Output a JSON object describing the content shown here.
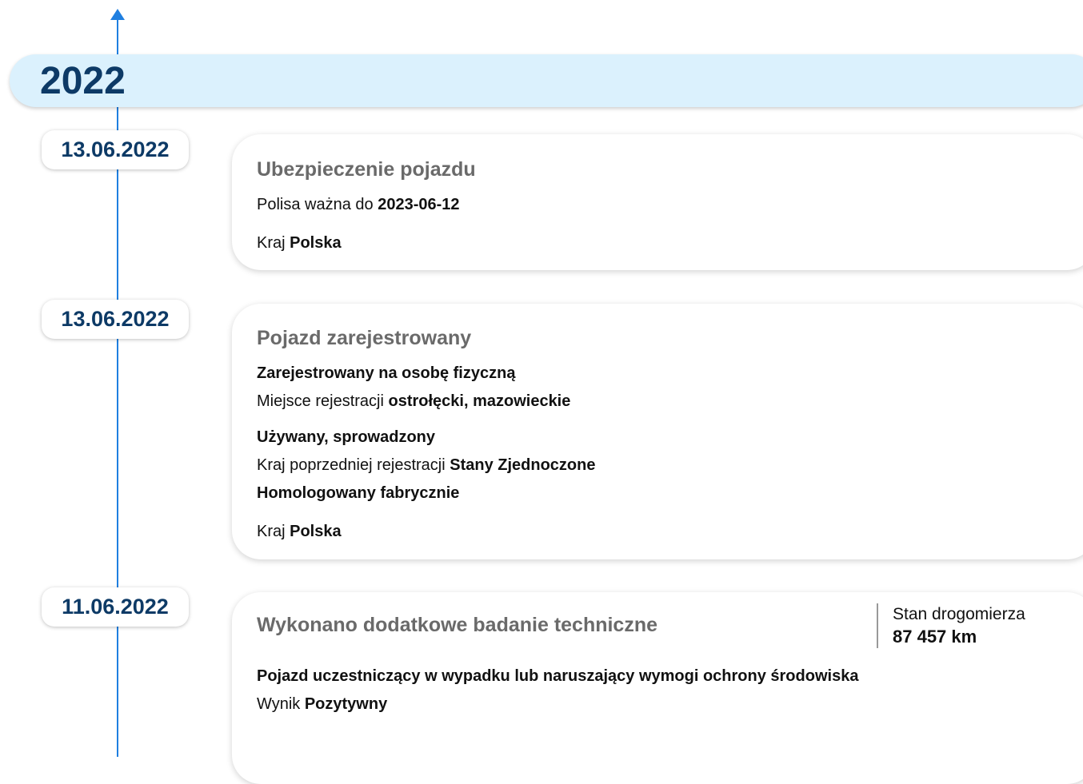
{
  "timeline": {
    "year": "2022",
    "events": [
      {
        "date": "13.06.2022",
        "title": "Ubezpieczenie pojazdu",
        "policy_label": "Polisa ważna do",
        "policy_value": "2023-06-12",
        "country_label": "Kraj",
        "country_value": "Polska"
      },
      {
        "date": "13.06.2022",
        "title": "Pojazd zarejestrowany",
        "owner_type": "Zarejestrowany na osobę fizyczną",
        "place_label": "Miejsce rejestracji",
        "place_value": "ostrołęcki, mazowieckie",
        "status": "Używany, sprowadzony",
        "prev_country_label": "Kraj poprzedniej rejestracji",
        "prev_country_value": "Stany Zjednoczone",
        "homologation": "Homologowany fabrycznie",
        "country_label": "Kraj",
        "country_value": "Polska"
      },
      {
        "date": "11.06.2022",
        "title": "Wykonano dodatkowe badanie techniczne",
        "odometer_label": "Stan drogomierza",
        "odometer_value": "87 457 km",
        "reason": "Pojazd uczestniczący w wypadku lub naruszający wymogi ochrony środowiska",
        "result_label": "Wynik",
        "result_value": "Pozytywny"
      }
    ]
  },
  "colors": {
    "accent": "#1f7fe0",
    "year_band": "#dbf1fd",
    "date_text": "#0d3a66",
    "card_title": "#6a6a6a"
  },
  "icons": {
    "timeline_top": "arrow-up-icon"
  }
}
